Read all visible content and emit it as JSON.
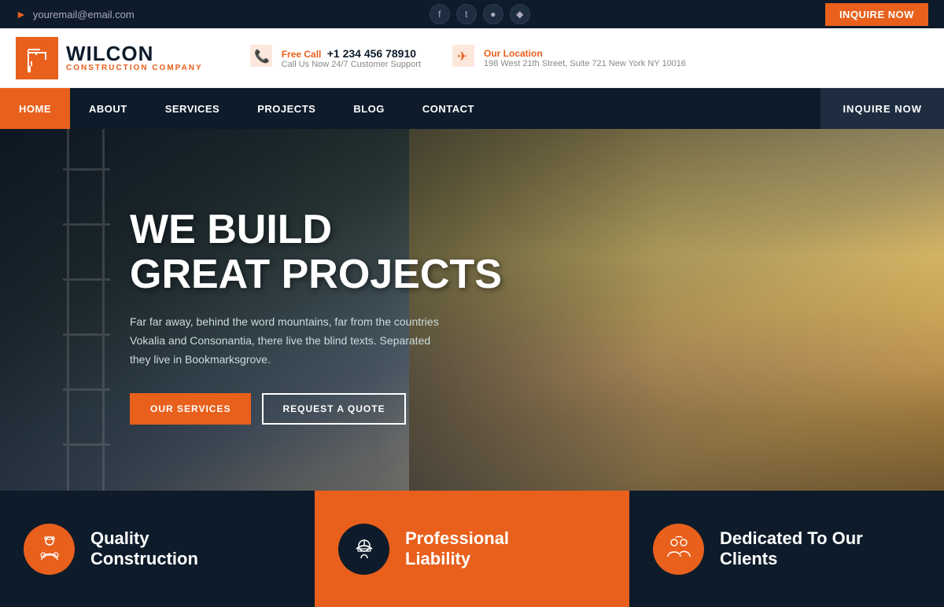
{
  "topbar": {
    "email": "youremail@email.com",
    "inquire_label": "INQUIRE NOW",
    "social": [
      "f",
      "t",
      "in",
      "d"
    ]
  },
  "header": {
    "logo_name": "WILCON",
    "logo_sub": "CONSTRUCTION COMPANY",
    "free_call_label": "Free Call",
    "phone": "+1 234 456 78910",
    "call_sub": "Call Us Now 24/7 Customer Support",
    "location_label": "Our Location",
    "location_value": "198 West 21th Street, Suite 721 New York NY 10016"
  },
  "navbar": {
    "items": [
      {
        "label": "HOME",
        "active": true
      },
      {
        "label": "ABOUT",
        "active": false
      },
      {
        "label": "SERVICES",
        "active": false
      },
      {
        "label": "PROJECTS",
        "active": false
      },
      {
        "label": "BLOG",
        "active": false
      },
      {
        "label": "CONTACT",
        "active": false
      }
    ],
    "inquire_label": "INQUIRE NOW"
  },
  "hero": {
    "title_line1": "WE BUILD",
    "title_line2": "GREAT PROJECTS",
    "description": "Far far away, behind the word mountains, far from the countries Vokalia and Consonantia, there live the blind texts. Separated they live in Bookmarksgrove.",
    "btn_services": "OUR SERVICES",
    "btn_quote": "REQUEST A QUOTE"
  },
  "bottom_cards": [
    {
      "title_line1": "Quality",
      "title_line2": "Construction",
      "type": "dark",
      "icon": "🏗"
    },
    {
      "title_line1": "Professional",
      "title_line2": "Liability",
      "type": "orange",
      "icon": "👷"
    },
    {
      "title_line1": "Dedicated To Our",
      "title_line2": "Clients",
      "type": "dark",
      "icon": "🔧"
    }
  ]
}
